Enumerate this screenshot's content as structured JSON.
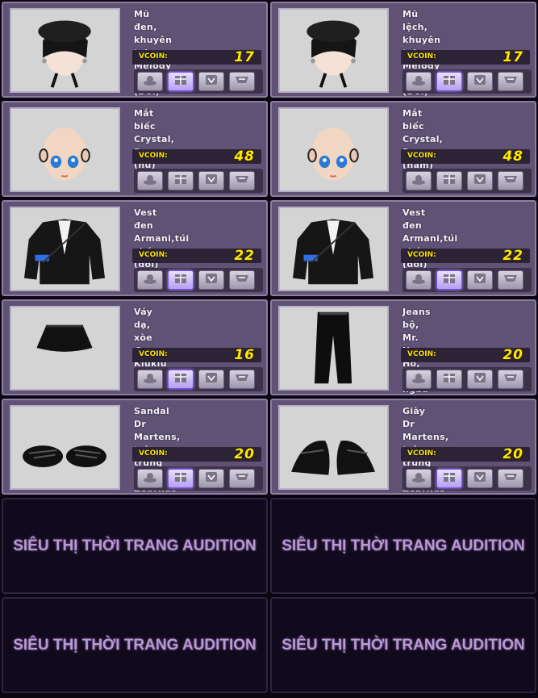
{
  "shop": {
    "coin_label": "VCOIN:",
    "banner_text": "SIÊU THỊ THỜI TRANG AUDITION",
    "items": [
      {
        "name": "Mũ đen, khuyên tai Melody Choco (Đôi)",
        "price": "17",
        "icon": "hat-earrings-icon",
        "active_button": 1
      },
      {
        "name": "Mũ lệch, khuyên tai Melody Choco (Đôi)",
        "price": "17",
        "icon": "hat-earrings-icon",
        "active_button": 1
      },
      {
        "name": "Mắt biếc Crystal, Ryon (nữ)",
        "price": "48",
        "icon": "face-eyes-icon",
        "active_button": -1
      },
      {
        "name": "Mắt biếc Crystal, Ryon (nam)",
        "price": "48",
        "icon": "face-eyes-icon",
        "active_button": -1
      },
      {
        "name": "Vest đen Armani,túi chéo (đôi)",
        "price": "22",
        "icon": "jacket-icon",
        "active_button": 1
      },
      {
        "name": "Vest đen Armani,túi chéo (đôi)",
        "price": "22",
        "icon": "jacket-icon",
        "active_button": 1
      },
      {
        "name": "Váy dạ, xòe đen Kiukiu",
        "price": "16",
        "icon": "skirt-icon",
        "active_button": 1
      },
      {
        "name": "Jeans bộ, Mr. Hero Hô, cool ngầu",
        "price": "20",
        "icon": "pants-icon",
        "active_button": -1
      },
      {
        "name": "Sandal Dr Martens, trẻ trung Fusion Zebrilus",
        "price": "20",
        "icon": "sandals-icon",
        "active_button": 1
      },
      {
        "name": "Giày Dr Martens, trẻ trung Fusion Zebrilus",
        "price": "20",
        "icon": "shoes-icon",
        "active_button": 1
      }
    ]
  },
  "colors": {
    "card_bg": "#5f5275",
    "price": "#ffe800",
    "banner_text": "#b69ad0"
  }
}
